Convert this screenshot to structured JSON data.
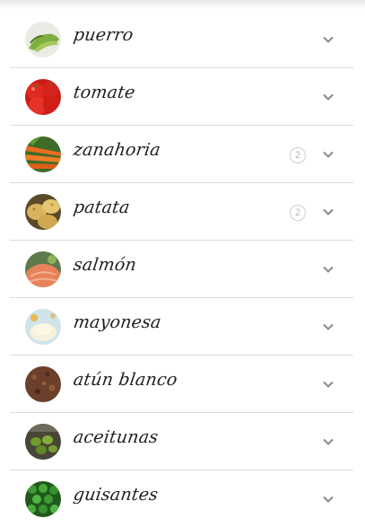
{
  "items": [
    {
      "label": "puerro",
      "icon": "leek-icon",
      "count": null
    },
    {
      "label": "tomate",
      "icon": "tomato-icon",
      "count": null
    },
    {
      "label": "zanahoria",
      "icon": "carrot-icon",
      "count": "2"
    },
    {
      "label": "patata",
      "icon": "potato-icon",
      "count": "2"
    },
    {
      "label": "salmón",
      "icon": "salmon-icon",
      "count": null
    },
    {
      "label": "mayonesa",
      "icon": "mayonnaise-icon",
      "count": null
    },
    {
      "label": "atún blanco",
      "icon": "tuna-icon",
      "count": null
    },
    {
      "label": "aceitunas",
      "icon": "olives-icon",
      "count": null
    },
    {
      "label": "guisantes",
      "icon": "peas-icon",
      "count": null
    }
  ],
  "expand_icon": "chevron-down-icon",
  "colors": {
    "divider": "#dcdcdc",
    "badge": "#b5b5b5",
    "chevron": "#8a8a8a"
  }
}
